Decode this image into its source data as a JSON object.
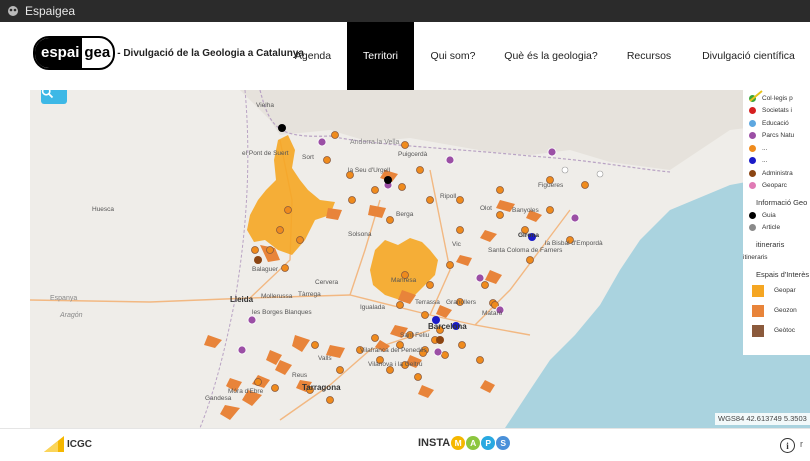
{
  "window": {
    "title": "Espaigea"
  },
  "site": {
    "logo_part1": "espai",
    "logo_part2": "gea",
    "tagline": "- Divulgació de la Geologia a Catalunya"
  },
  "nav": [
    {
      "label": "Agenda",
      "active": false
    },
    {
      "label": "Territori",
      "active": true
    },
    {
      "label": "Qui som?",
      "active": false
    },
    {
      "label": "Què és la geologia?",
      "active": false
    },
    {
      "label": "Recursos",
      "active": false
    },
    {
      "label": "Divulgació científica",
      "active": false
    }
  ],
  "map": {
    "places": [
      "Vielha",
      "el Pont de Suert",
      "Sort",
      "la Seu d'Urgell",
      "Puigcerdà",
      "Ripoll",
      "Figueres",
      "Berga",
      "Olot",
      "Banyoles",
      "Girona",
      "la Bisbal d'Empordà",
      "Solsona",
      "Vic",
      "Santa Coloma de Farners",
      "Balaguer",
      "Cervera",
      "Manresa",
      "Igualada",
      "Terrassa",
      "Granollers",
      "Mataró",
      "Lleida",
      "Mollerussa",
      "Tàrrega",
      "les Borges Blanques",
      "Barcelona",
      "Sant Feliu",
      "Valls",
      "Vilafranca del Penedès",
      "Vilanova i la Geltrú",
      "Reus",
      "Tarragona",
      "Móra d'Ebre",
      "Gandesa",
      "Andorra la Vella",
      "Huesca",
      "Aragón",
      "Espanya"
    ],
    "coords": "WGS84 42.613749 5.3503"
  },
  "legend": {
    "entities": [
      {
        "label": "Col·legis p",
        "color": "#3aa63a"
      },
      {
        "label": "Societats i",
        "color": "#d62020"
      },
      {
        "label": "Educació",
        "color": "#5da7e0"
      },
      {
        "label": "Parcs Natu",
        "color": "#9b4fa5"
      },
      {
        "label": "...",
        "color": "#ef8b1d"
      },
      {
        "label": "...",
        "color": "#1a1ac8"
      },
      {
        "label": "Administra",
        "color": "#8b4513"
      },
      {
        "label": "Geoparc",
        "color": "#e07bb5"
      }
    ],
    "info_title": "Informació Geo",
    "info": [
      {
        "label": "Guia",
        "color": "#000000"
      },
      {
        "label": "Article",
        "color": "#8a8a8a"
      }
    ],
    "itin_title": "itineraris",
    "itin_label": "itineraris",
    "espais_title": "Espais d'Interès",
    "espais": [
      {
        "label": "Geopar",
        "color": "#f5a623"
      },
      {
        "label": "Geozon",
        "color": "#e8843a"
      },
      {
        "label": "Geòtoc",
        "color": "#8b5a3c"
      }
    ]
  },
  "footer": {
    "icgc": "ICGC",
    "insta": "INSTA",
    "maps_letters": [
      "M",
      "A",
      "P",
      "S"
    ],
    "maps_colors": [
      "#f5b700",
      "#8cc63f",
      "#29a9e1",
      "#4a90d9"
    ],
    "info_symbol": "i",
    "more_symbol": "r"
  }
}
